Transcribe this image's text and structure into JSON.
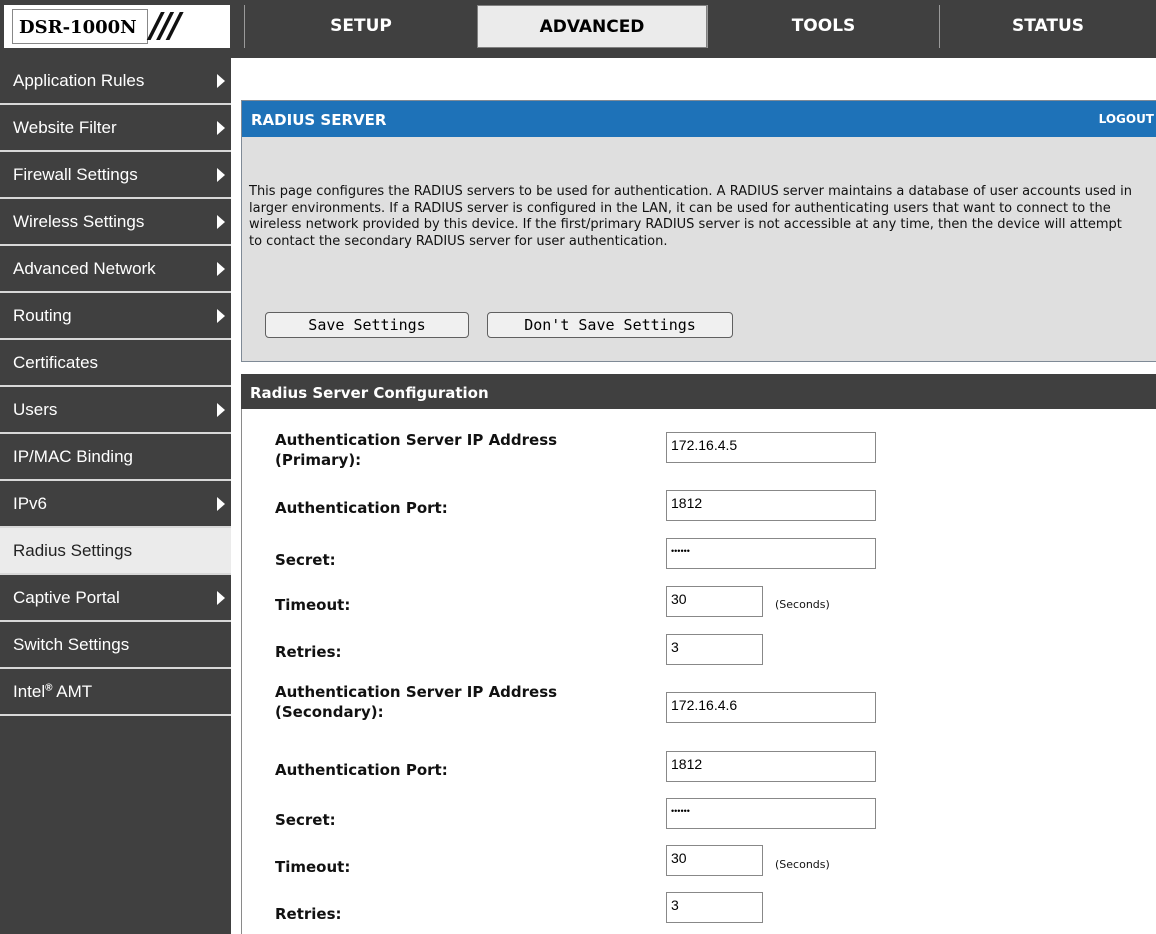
{
  "brand": {
    "label": "DSR-1000N",
    "mark": "///"
  },
  "tabs": [
    {
      "label": "SETUP"
    },
    {
      "label": "ADVANCED"
    },
    {
      "label": "TOOLS"
    },
    {
      "label": "STATUS"
    }
  ],
  "active_tab": "ADVANCED",
  "sidebar": {
    "items": [
      {
        "label": "Application Rules",
        "has_submenu": true
      },
      {
        "label": "Website Filter",
        "has_submenu": true
      },
      {
        "label": "Firewall Settings",
        "has_submenu": true
      },
      {
        "label": "Wireless Settings",
        "has_submenu": true
      },
      {
        "label": "Advanced Network",
        "has_submenu": true
      },
      {
        "label": "Routing",
        "has_submenu": true
      },
      {
        "label": "Certificates",
        "has_submenu": false
      },
      {
        "label": "Users",
        "has_submenu": true
      },
      {
        "label": "IP/MAC Binding",
        "has_submenu": false
      },
      {
        "label": "IPv6",
        "has_submenu": true
      },
      {
        "label": "Radius Settings",
        "has_submenu": false,
        "active": true
      },
      {
        "label": "Captive Portal",
        "has_submenu": true
      },
      {
        "label": "Switch Settings",
        "has_submenu": false
      },
      {
        "label": "Intel",
        "sup": "®",
        "suffix": " AMT",
        "has_submenu": false
      }
    ]
  },
  "radius_panel": {
    "title": "RADIUS SERVER",
    "logout": "LOGOUT",
    "description": "This page configures the RADIUS servers to be used for authentication. A RADIUS server maintains a database of user accounts used in larger environments. If a RADIUS server is configured in the LAN, it can be used for authenticating users that want to connect to the wireless network provided by this device. If the first/primary RADIUS server is not accessible at any time, then the device will attempt to contact the secondary RADIUS server for user authentication.",
    "save_label": "Save Settings",
    "dont_save_label": "Don't Save Settings"
  },
  "config": {
    "title": "Radius Server Configuration",
    "primary": {
      "ip_label_1": "Authentication Server IP Address",
      "ip_label_2": "(Primary):",
      "ip_value": "172.16.4.5",
      "port_label": "Authentication Port:",
      "port_value": "1812",
      "secret_label": "Secret:",
      "secret_value": "••••••",
      "timeout_label": "Timeout:",
      "timeout_value": "30",
      "timeout_unit": "(Seconds)",
      "retries_label": "Retries:",
      "retries_value": "3"
    },
    "secondary": {
      "ip_label_1": "Authentication Server IP Address",
      "ip_label_2": "(Secondary):",
      "ip_value": "172.16.4.6",
      "port_label": "Authentication Port:",
      "port_value": "1812",
      "secret_label": "Secret:",
      "secret_value": "••••••",
      "timeout_label": "Timeout:",
      "timeout_value": "30",
      "timeout_unit": "(Seconds)",
      "retries_label": "Retries:",
      "retries_value": "3"
    }
  },
  "colors": {
    "panel_header": "#1e72b8",
    "dark_bar": "#404040",
    "panel_bg": "#dfdfdf",
    "active_bg": "#ebebeb"
  }
}
